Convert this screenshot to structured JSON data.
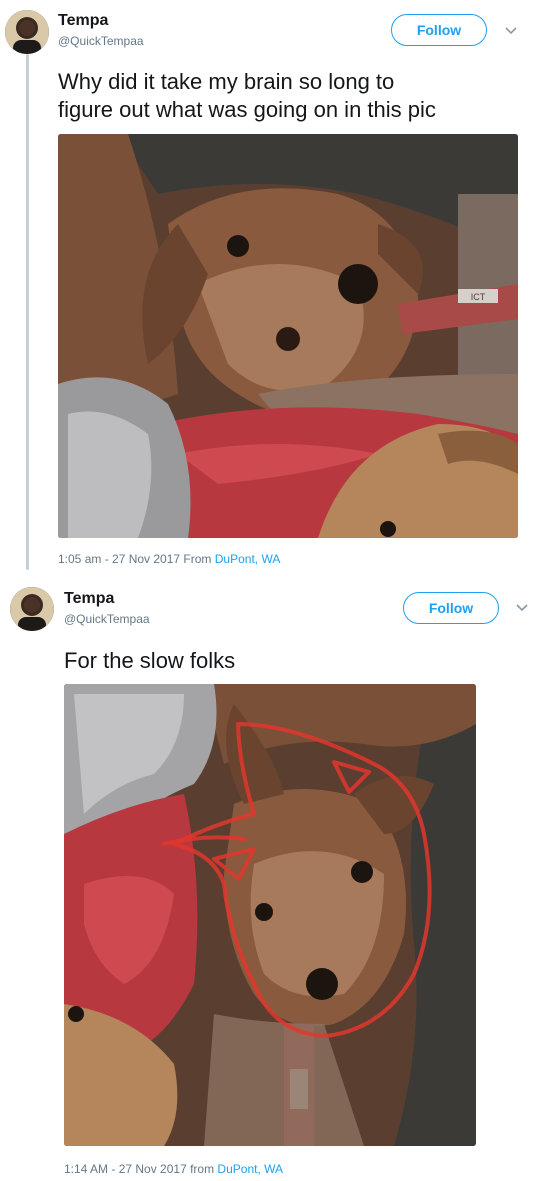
{
  "tweets": [
    {
      "author_name": "Tempa",
      "author_handle": "@QuickTempaa",
      "follow_label": "Follow",
      "text_lines": [
        "Why did it take my brain so long to",
        "figure out what was going on in this pic"
      ],
      "timestamp_prefix": "1:05 am - 27 Nov 2017 From ",
      "location": "DuPont, WA",
      "photo_subject": "dog photo"
    },
    {
      "author_name": "Tempa",
      "author_handle": "@QuickTempaa",
      "follow_label": "Follow",
      "text": "For the slow folks",
      "timestamp_prefix": "1:14 AM - 27 Nov 2017 from ",
      "location": "DuPont, WA",
      "photo_subject": "dog photo with red outline"
    }
  ],
  "collar_text": "ICT",
  "colors": {
    "link_blue": "#1da1f2",
    "text_dark": "#14171a",
    "text_muted": "#657786",
    "thread_line": "#c4cfd6",
    "annotation_red": "#e3362d"
  },
  "icons": {
    "chevron": "chevron-down-icon"
  }
}
